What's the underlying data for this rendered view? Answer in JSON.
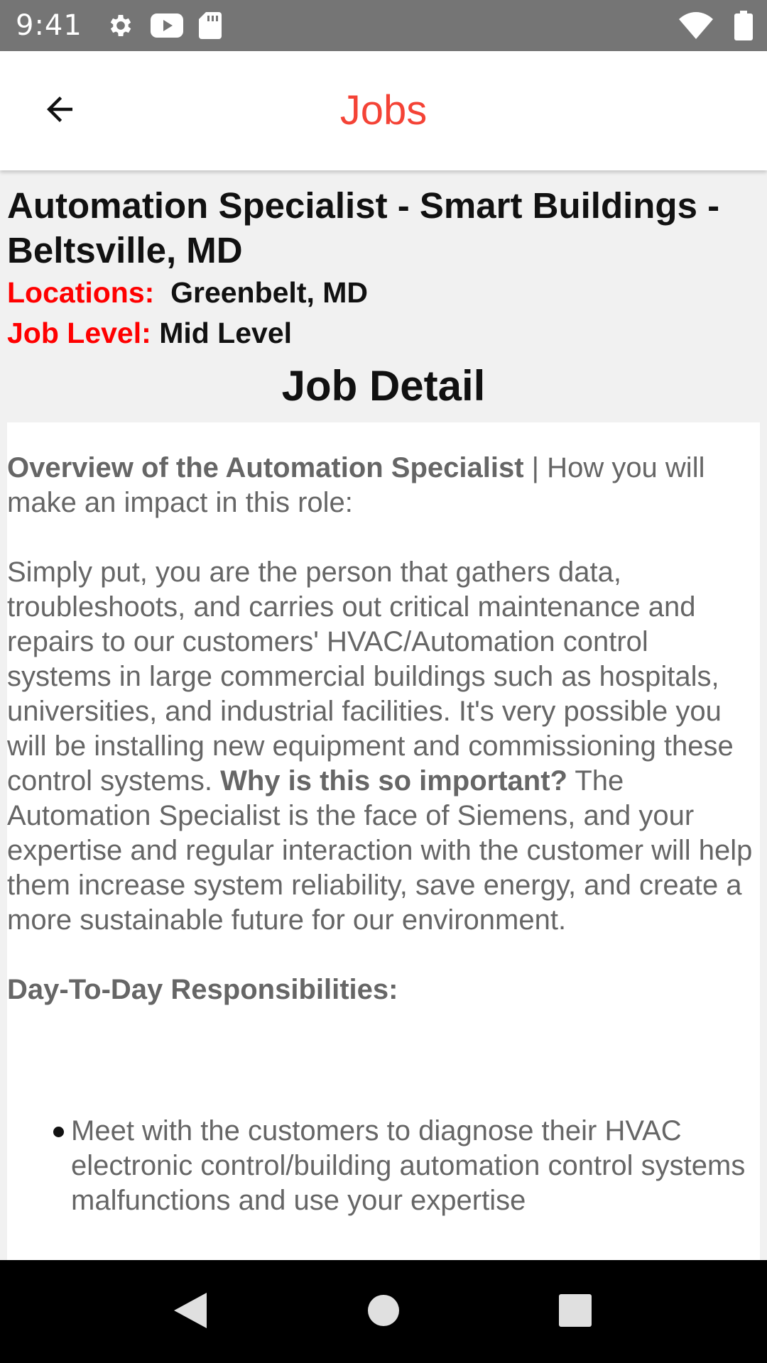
{
  "status_bar": {
    "time": "9:41",
    "left_icons": [
      "gear-icon",
      "youtube-icon",
      "sd-card-icon"
    ],
    "right_icons": [
      "wifi-icon",
      "battery-icon"
    ]
  },
  "app_bar": {
    "title": "Jobs",
    "back_icon": "arrow-back-icon",
    "title_color": "#f44336"
  },
  "job": {
    "title": "Automation Specialist - Smart Buildings - Beltsville, MD",
    "locations_label": "Locations:",
    "locations_value": "Greenbelt, MD",
    "level_label": "Job Level:",
    "level_value": "Mid Level",
    "label_color": "#ff0000"
  },
  "detail": {
    "heading": "Job Detail",
    "overview_bold": "Overview of the Automation Specialist",
    "overview_rest": " | How you will make an impact in this role:",
    "para1_start": "Simply put, you are the person that gathers data, troubleshoots, and carries out critical maintenance and repairs to our customers' HVAC/Automation control systems in large commercial buildings such as hospitals, universities, and industrial facilities. It's very possible you will be installing new equipment and commissioning these control systems. ",
    "para1_bold": "Why is this so important?",
    "para1_end": " The Automation Specialist is the face of Siemens, and your expertise and regular interaction with the customer will help them increase system reliability, save energy, and create a more sustainable future for our environment.",
    "responsibilities_heading": "Day-To-Day Responsibilities:",
    "responsibilities": [
      "Meet with the customers to diagnose their HVAC electronic control/building automation control systems malfunctions and use your expertise"
    ]
  },
  "nav_bar": {
    "icons": [
      "nav-back-icon",
      "nav-home-icon",
      "nav-recents-icon"
    ]
  }
}
